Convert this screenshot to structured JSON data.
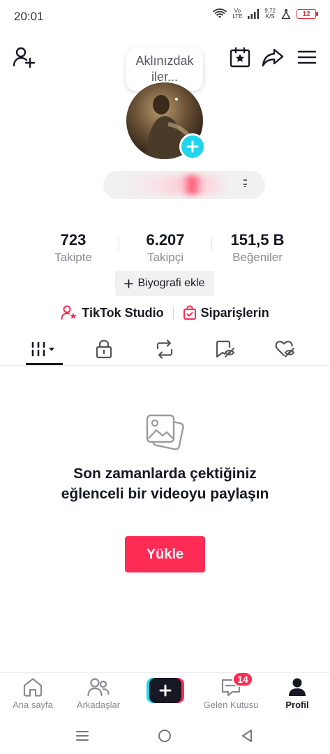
{
  "status_bar": {
    "time": "20:01",
    "network_label_top": "Vo",
    "network_label_bottom": "LTE",
    "speed_value": "9,72",
    "speed_unit": "K/S",
    "battery": "12",
    "battery_color": "#e0303a"
  },
  "header": {
    "thought_bubble": "Aklınızdak iler...",
    "icons": [
      "add-friend-icon",
      "calendar-star-icon",
      "share-icon",
      "menu-icon"
    ]
  },
  "stats": [
    {
      "value": "723",
      "label": "Takipte"
    },
    {
      "value": "6.207",
      "label": "Takipçi"
    },
    {
      "value": "151,5 B",
      "label": "Beğeniler"
    }
  ],
  "bio_button": "Biyografi ekle",
  "links": {
    "studio": "TikTok Studio",
    "orders": "Siparişlerin"
  },
  "tabs": [
    "videos-grid-icon",
    "lock-icon",
    "repost-icon",
    "favorites-icon",
    "liked-icon"
  ],
  "empty_state": {
    "message": "Son zamanlarda çektiğiniz eğlenceli bir videoyu paylaşın",
    "upload_button": "Yükle"
  },
  "bottom_nav": {
    "home": "Ana sayfa",
    "friends": "Arkadaşlar",
    "inbox": "Gelen Kutusu",
    "inbox_badge": "14",
    "profile": "Profil"
  },
  "colors": {
    "accent": "#fe2c55",
    "cyan": "#20d5ec",
    "text": "#161823",
    "muted": "#8a8b91"
  }
}
